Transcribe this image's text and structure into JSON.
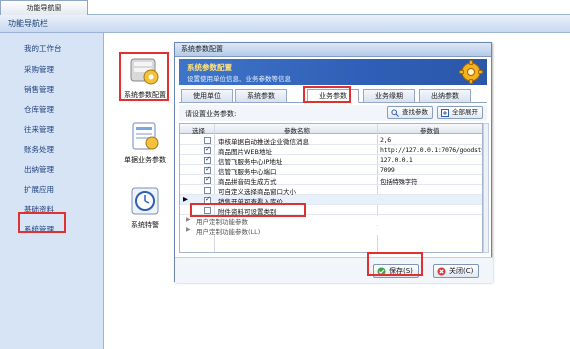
{
  "top_tab": {
    "label": "功能导航窗"
  },
  "nav": {
    "header": "功能导航栏",
    "items": [
      "我的工作台",
      "采购管理",
      "销售管理",
      "仓库管理",
      "往来管理",
      "账务处理",
      "出纳管理",
      "扩展应用",
      "基础资料",
      "系统管理"
    ]
  },
  "content_icons": [
    {
      "label": "系统参数配置",
      "icon": "system-config-icon"
    },
    {
      "label": "单据业务参数",
      "icon": "document-params-icon"
    },
    {
      "label": "系统特警",
      "icon": "clock-icon"
    }
  ],
  "dialog": {
    "title": "系统参数配置",
    "banner_title": "系统参数配置",
    "banner_sub": "设置使用单位信息、业务参数等信息",
    "tabs": [
      "使用单位",
      "系统参数",
      "业务参数",
      "业务参数",
      "业务缘期",
      "出纳参数"
    ],
    "active_tab": "业务参数",
    "param_label": "请设置业务参数:",
    "search_button": "查找参数",
    "expand_button": "全部展开",
    "grid_headers": {
      "select": "选择",
      "name": "参数名称",
      "value": "参数值"
    },
    "rows": [
      {
        "name": "审核单据自动推送企业微信消息",
        "value": "2,6",
        "checked": false
      },
      {
        "name": "商品图片WEB地址",
        "value": "http://127.0.0.1:7076/goodstype",
        "checked": true
      },
      {
        "name": "信管飞服务中心IP地址",
        "value": "127.0.0.1",
        "checked": true
      },
      {
        "name": "信管飞服务中心端口",
        "value": "7099",
        "checked": true
      },
      {
        "name": "商品拼音码生成方式",
        "value": "包括特殊字符",
        "checked": true
      },
      {
        "name": "可自定义选择商品窗口大小",
        "value": "",
        "checked": false
      },
      {
        "name": "销售开单可查看入库价",
        "value": "",
        "checked": true
      },
      {
        "name": "附件资料可设置类别",
        "value": "",
        "checked": false
      }
    ],
    "groups": [
      "用户定制功能参数",
      "用户定制功能参数(LL)"
    ],
    "save_button": "保存(S)",
    "close_button": "关闭(C)"
  },
  "colors": {
    "highlight": "#e03030",
    "banner": "#3f75c8",
    "nav_bg": "#d6e4f6"
  }
}
